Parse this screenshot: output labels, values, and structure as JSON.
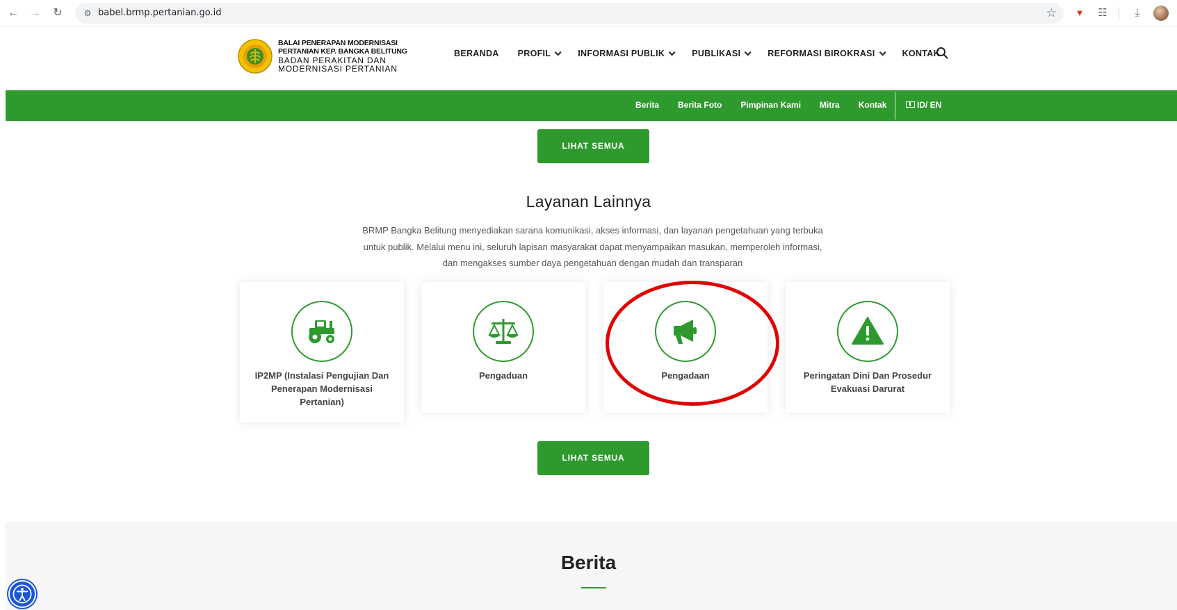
{
  "browser": {
    "url": "babel.brmp.pertanian.go.id"
  },
  "header": {
    "logo_lines": [
      "BALAI PENERAPAN MODERNISASI",
      "PERTANIAN KEP. BANGKA BELITUNG",
      "BADAN PERAKITAN DAN",
      "MODERNISASI PERTANIAN"
    ],
    "nav": [
      {
        "label": "BERANDA",
        "has_dropdown": false
      },
      {
        "label": "PROFIL",
        "has_dropdown": true
      },
      {
        "label": "INFORMASI PUBLIK",
        "has_dropdown": true
      },
      {
        "label": "PUBLIKASI",
        "has_dropdown": true
      },
      {
        "label": "REFORMASI BIROKRASI",
        "has_dropdown": true
      },
      {
        "label": "KONTAK",
        "has_dropdown": false
      }
    ]
  },
  "topbar": {
    "links": [
      "Berita",
      "Berita Foto",
      "Pimpinan Kami",
      "Mitra",
      "Kontak"
    ],
    "language": "ID/ EN"
  },
  "buttons": {
    "see_all_top": "LIHAT SEMUA",
    "see_all_bottom": "LIHAT SEMUA"
  },
  "layanan": {
    "title": "Layanan Lainnya",
    "description": "BRMP Bangka Belitung menyediakan sarana komunikasi, akses informasi, dan layanan pengetahuan yang terbuka untuk publik. Melalui menu ini, seluruh lapisan masyarakat dapat menyampaikan masukan, memperoleh informasi, dan mengakses sumber daya pengetahuan dengan mudah dan transparan",
    "cards": [
      {
        "label": "IP2MP (Instalasi Pengujian Dan Penerapan Modernisasi Pertanian)",
        "icon": "tractor-icon"
      },
      {
        "label": "Pengaduan",
        "icon": "scale-icon"
      },
      {
        "label": "Pengadaan",
        "icon": "megaphone-icon"
      },
      {
        "label": "Peringatan Dini Dan Prosedur Evakuasi Darurat",
        "icon": "warning-icon"
      }
    ]
  },
  "berita": {
    "title": "Berita"
  },
  "colors": {
    "brand_green": "#2e9a2e",
    "annotation_red": "#e10000",
    "accessibility_blue": "#1a56d6"
  }
}
